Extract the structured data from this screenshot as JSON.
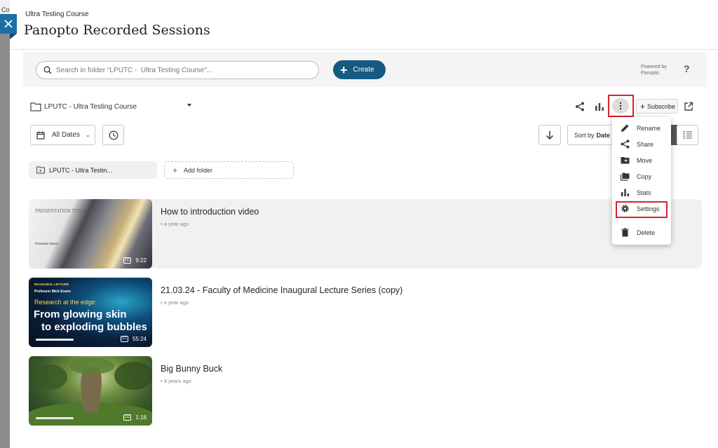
{
  "header": {
    "course_label": "Ultra Testing Course",
    "page_title": "Panopto Recorded Sessions",
    "left_stub": "Co"
  },
  "search": {
    "placeholder": "Search in folder \"LPUTC -  Ultra Testing Course\"...",
    "create_label": "Create",
    "powered_line1": "Powered by",
    "powered_line2": "Panopto",
    "help_label": "?"
  },
  "folder": {
    "name": "LPUTC - Ultra Testing Course",
    "subscribe_label": "Subscribe"
  },
  "filters": {
    "date_label": "All Dates",
    "sort_prefix": "Sort by",
    "sort_value": "Date"
  },
  "subfolders": {
    "item_label": "LPUTC - Ultra Testin...",
    "add_label": "Add folder"
  },
  "sessions": [
    {
      "title": "How to introduction video",
      "age": "a year ago",
      "duration": "9:22",
      "cc": "CC",
      "thumb_title": "PRESENTATION TITLE",
      "thumb_name": "Presenter Name"
    },
    {
      "title": "21.03.24 - Faculty of Medicine Inaugural Lecture Series (copy)",
      "age": "a year ago",
      "duration": "55:24",
      "cc": "CC",
      "thumb_l1": "INAUGURAL LECTURE",
      "thumb_l2": "Professor Mick Evans",
      "thumb_l3": "Research at the edge:",
      "thumb_l4": "From glowing skin",
      "thumb_l5": "to exploding bubbles",
      "progress": 0.35
    },
    {
      "title": "Big Bunny Buck",
      "age": "9 years ago",
      "duration": "1:16",
      "cc": "CC",
      "progress": 0.35
    }
  ],
  "menu": {
    "items": [
      {
        "label": "Rename",
        "icon": "pencil-icon"
      },
      {
        "label": "Share",
        "icon": "share-icon"
      },
      {
        "label": "Move",
        "icon": "move-folder-icon"
      },
      {
        "label": "Copy",
        "icon": "copy-icon"
      },
      {
        "label": "Stats",
        "icon": "stats-icon"
      },
      {
        "label": "Settings",
        "icon": "gear-icon"
      },
      {
        "label": "Delete",
        "icon": "trash-icon"
      }
    ]
  },
  "colors": {
    "accent": "#155a80",
    "close_button": "#1c6fa3",
    "highlight_box": "#d9232a"
  }
}
